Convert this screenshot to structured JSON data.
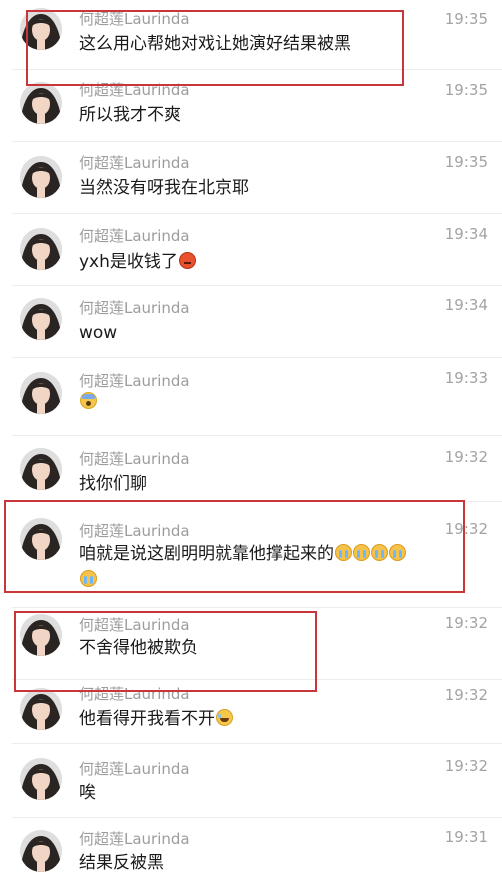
{
  "colors": {
    "highlight": "#c8363a",
    "username": "#9d9d9d",
    "time": "#a3a3a3",
    "content": "#1a1a1a"
  },
  "comments": [
    {
      "username": "何超莲Laurinda",
      "time": "19:35",
      "text": "这么用心帮她对戏让她演好结果被黑",
      "emojis": [],
      "highlighted": true
    },
    {
      "username": "何超莲Laurinda",
      "time": "19:35",
      "text": "所以我才不爽",
      "emojis": [],
      "highlighted": false
    },
    {
      "username": "何超莲Laurinda",
      "time": "19:35",
      "text": "当然没有呀我在北京耶",
      "emojis": [],
      "highlighted": false
    },
    {
      "username": "何超莲Laurinda",
      "time": "19:34",
      "text": "yxh是收钱了",
      "emojis": [
        "angry-face-icon"
      ],
      "highlighted": false
    },
    {
      "username": "何超莲Laurinda",
      "time": "19:34",
      "text": "wow",
      "emojis": [],
      "highlighted": false
    },
    {
      "username": "何超莲Laurinda",
      "time": "19:33",
      "text": "",
      "emojis": [
        "screaming-face-icon"
      ],
      "highlighted": false
    },
    {
      "username": "何超莲Laurinda",
      "time": "19:32",
      "text": "找你们聊",
      "emojis": [],
      "highlighted": false
    },
    {
      "username": "何超莲Laurinda",
      "time": "19:32",
      "text": "咱就是说这剧明明就靠他撑起来的",
      "emojis": [
        "crying-face-icon",
        "crying-face-icon",
        "crying-face-icon",
        "crying-face-icon",
        "crying-face-icon"
      ],
      "highlighted": true
    },
    {
      "username": "何超莲Laurinda",
      "time": "19:32",
      "text": "不舍得他被欺负",
      "emojis": [],
      "highlighted": true
    },
    {
      "username": "何超莲Laurinda",
      "time": "19:32",
      "text": "他看得开我看不开",
      "emojis": [
        "laughing-tears-face-icon"
      ],
      "highlighted": false
    },
    {
      "username": "何超莲Laurinda",
      "time": "19:32",
      "text": "唉",
      "emojis": [],
      "highlighted": false
    },
    {
      "username": "何超莲Laurinda",
      "time": "19:31",
      "text": "结果反被黑",
      "emojis": [],
      "highlighted": false
    }
  ]
}
